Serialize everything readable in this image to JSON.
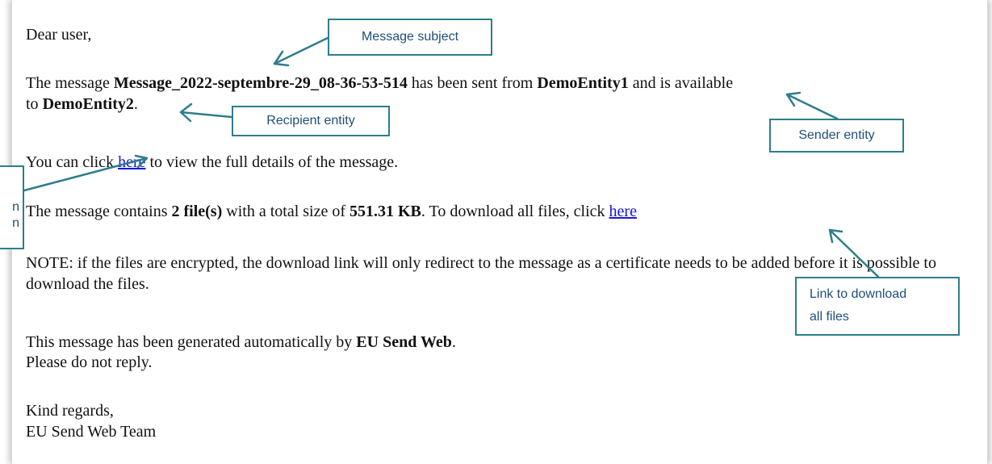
{
  "email": {
    "greeting": "Dear user,",
    "line1_pre": "The message ",
    "message_subject": "Message_2022-septembre-29_08-36-53-514",
    "line1_mid": " has been sent from ",
    "sender_entity": "DemoEntity1",
    "line1_post": " and is available",
    "line2_pre": "to ",
    "recipient_entity": "DemoEntity2",
    "line2_post": ".",
    "details_pre": "You can click ",
    "details_link": "here",
    "details_post": " to view the full details of the message.",
    "files_pre": "The message contains ",
    "file_count": "2 file(s)",
    "files_mid": " with a total size of ",
    "total_size": "551.31 KB",
    "files_post": ". To download all files, click ",
    "download_link": "here",
    "note": "NOTE: if the files are encrypted, the download link will only redirect to the message as a certificate needs to be added before it is possible to download the files.",
    "generated_pre": "This message has been generated automatically by ",
    "generated_app": "EU Send Web",
    "generated_post": ".",
    "no_reply": "Please do not reply.",
    "closing": "Kind regards,",
    "signature": "EU Send Web Team"
  },
  "callouts": {
    "subject": "Message subject",
    "recipient": "Recipient entity",
    "sender": "Sender entity",
    "download_line1": "Link to download",
    "download_line2": "all files",
    "left_line1": "n",
    "left_line2": "n"
  },
  "colors": {
    "callout_border": "#2e7d8c",
    "callout_text": "#1f4e79",
    "link": "#1616d6"
  }
}
